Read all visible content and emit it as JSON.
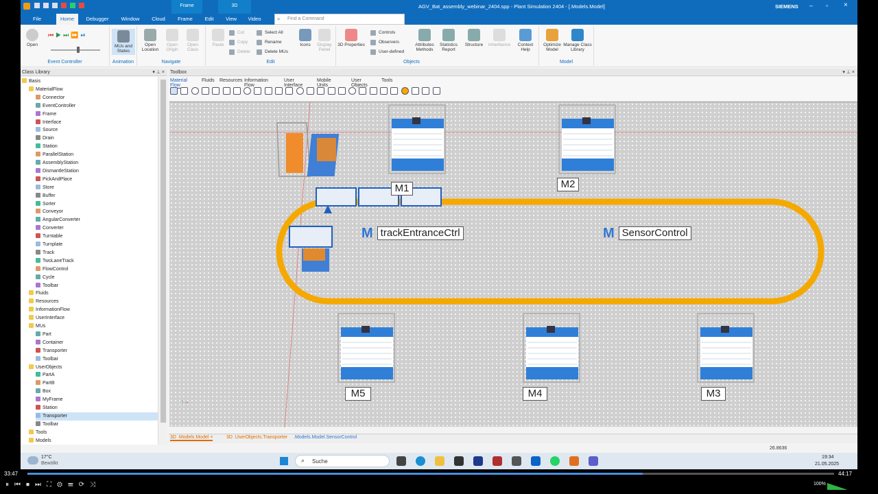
{
  "window": {
    "title": "AGV_Bat_assembly_webinar_2404.spp - Plant Simulation 2404 - [.Models.Model]",
    "brand": "SIEMENS"
  },
  "context_tabs": [
    "Frame",
    "3D"
  ],
  "ribbon_tabs": [
    "File",
    "Home",
    "Debugger",
    "Window",
    "Cloud",
    "Frame",
    "Edit",
    "View",
    "Video"
  ],
  "active_tab": "Home",
  "search": {
    "placeholder": "Find a Command"
  },
  "ribbon": {
    "groups": [
      "Event Controller",
      "Animation",
      "Navigate",
      "Edit",
      "Objects",
      "Model"
    ],
    "open": "Open",
    "mus_and_states": "MUs and States",
    "open_location": "Open Location",
    "open_origin": "Open Origin",
    "open_class": "Open Class",
    "paste": "Paste",
    "cut": "Cut",
    "copy": "Copy",
    "delete": "Delete",
    "select_all": "Select All",
    "rename": "Rename",
    "delete_mus": "Delete MUs",
    "icons": "Icons",
    "display_panel": "Display Panel",
    "properties_3d": "3D Properties",
    "controls": "Controls",
    "observers": "Observers",
    "user_defined": "User-defined",
    "attributes_methods": "Attributes Methods",
    "statistics_report": "Statistics Report",
    "structure": "Structure",
    "inheritance": "Inheritance",
    "context_help": "Context Help",
    "optimize_model": "Optimize Model",
    "manage_class_library": "Manage Class Library"
  },
  "class_library": {
    "title": "Class Library",
    "items": [
      "Basis",
      "MaterialFlow",
      "Connector",
      "EventController",
      "Frame",
      "Interface",
      "Source",
      "Drain",
      "Station",
      "ParallelStation",
      "AssemblyStation",
      "DismantleStation",
      "PickAndPlace",
      "Store",
      "Buffer",
      "Sorter",
      "Conveyor",
      "AngularConverter",
      "Converter",
      "Turntable",
      "Turnplate",
      "Track",
      "TwoLaneTrack",
      "FlowControl",
      "Cycle",
      "Toolbar",
      "Fluids",
      "Resources",
      "InformationFlow",
      "UserInterface",
      "MUs",
      "Part",
      "Container",
      "Transporter",
      "Toolbar",
      "UserObjects",
      "PartA",
      "PartB",
      "Box",
      "MyFrame",
      "Station",
      "Transporter",
      "Toolbar",
      "Tools",
      "Models"
    ]
  },
  "toolbox": {
    "title": "Toolbox",
    "tabs": [
      "Material Flow",
      "Fluids",
      "Resources",
      "Information Flow",
      "User Interface",
      "Mobile Units",
      "User Objects",
      "Tools"
    ]
  },
  "model": {
    "stations": [
      "M1",
      "M2",
      "M3",
      "M4",
      "M5"
    ],
    "methods": [
      "trackEntranceCtrl",
      "SensorControl"
    ]
  },
  "doc_tabs": [
    "3D .Models.Model",
    "3D .UserObjects.Transporter",
    ".Models.Model.SensorControl"
  ],
  "status_value": "26.8636",
  "taskbar": {
    "weather_temp": "17°C",
    "weather_desc": "Bewölkt",
    "search": "Suche",
    "time": "19:34",
    "date": "21.05.2025"
  },
  "player": {
    "elapsed": "33:47",
    "total": "44:17",
    "volume": "100%",
    "progress": 0.763
  }
}
